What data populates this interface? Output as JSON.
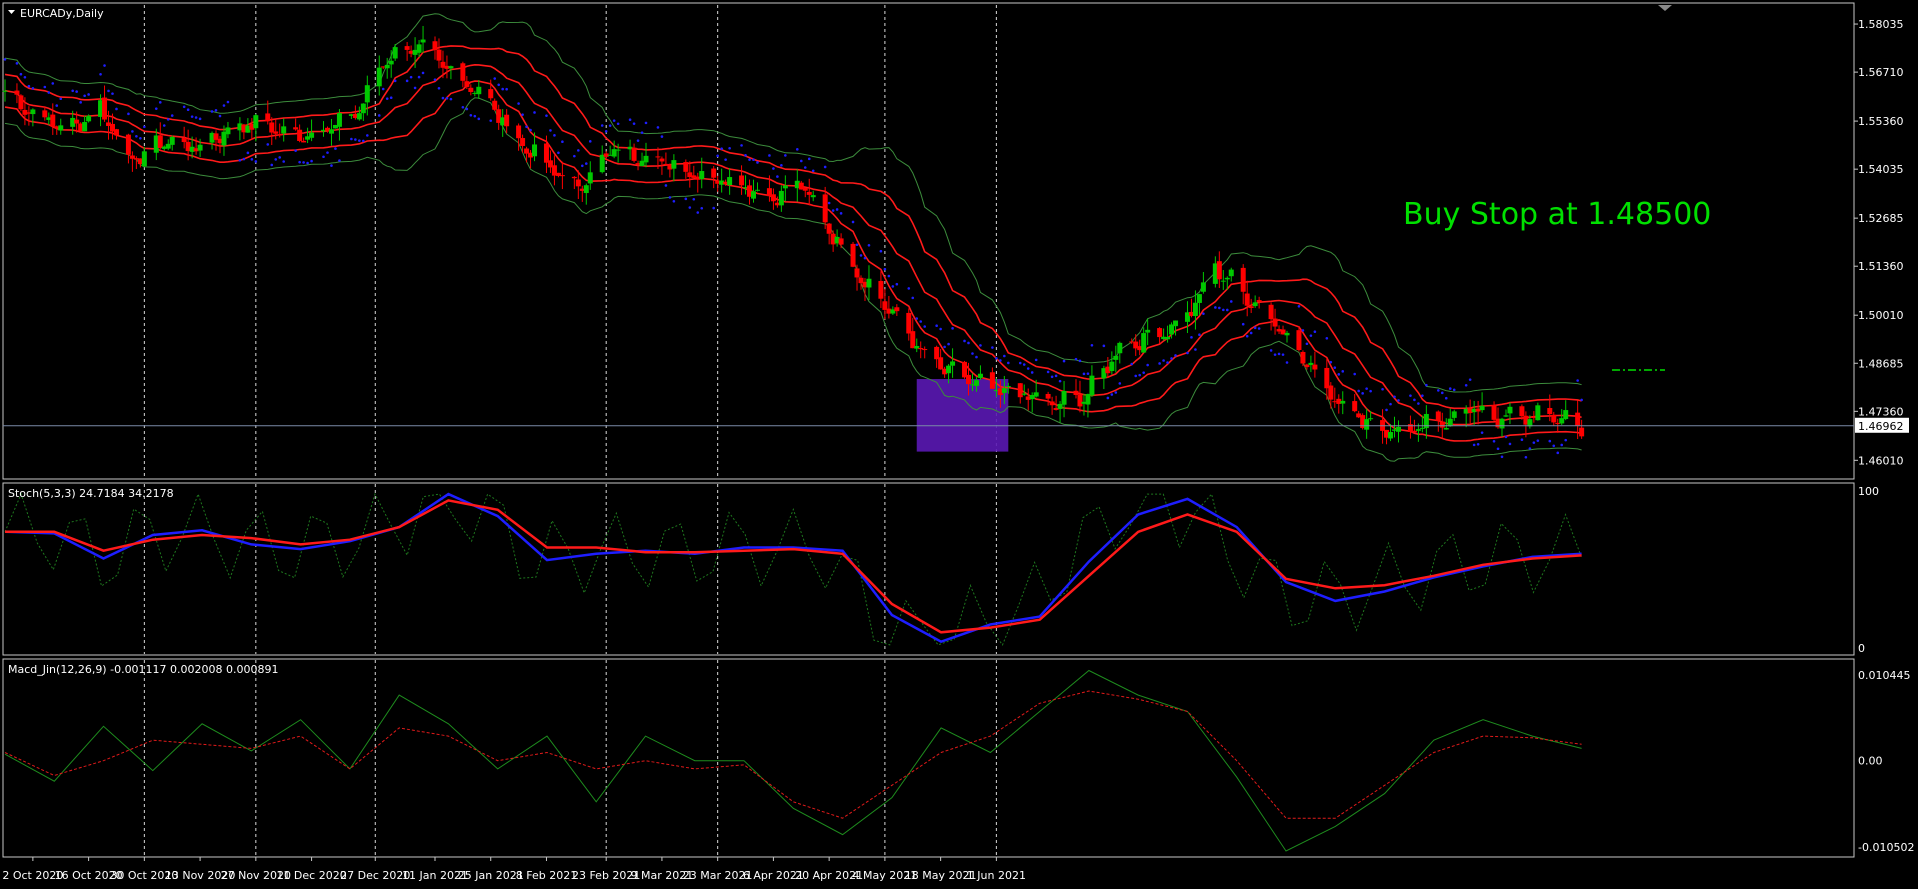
{
  "window": {
    "symbol_label": "EURCADy,Daily",
    "annotation_text": "Buy Stop at 1.48500",
    "current_price_label": "1.46962",
    "panes": {
      "stoch_label": "Stoch(5,3,3) 24.7184 34.2178",
      "macd_label": "Macd_Jin(12,26,9) -0.001117 0.002008 0.000891"
    }
  },
  "colors": {
    "background": "#000000",
    "frame": "#c8c8c8",
    "bull": "#00c800",
    "bear": "#ff0000",
    "ma": "#ff1a1a",
    "bollinger": "#3c8c3c",
    "sar": "#1e1eff",
    "grid": "#ffffff",
    "annotation": "#00e000",
    "box": "#5a18b4",
    "stoch_main": "#1e1eff",
    "stoch_signal": "#ff1a1a",
    "stoch_raw": "#1e781e",
    "macd_line": "#1e8c1e",
    "macd_signal": "#e01a1a",
    "axis_text": "#ffffff"
  },
  "chart_data": [
    {
      "type": "candlestick",
      "pane": "price",
      "ylim": [
        1.4555,
        1.5856
      ],
      "yticks": [
        "1.58035",
        "1.56710",
        "1.55360",
        "1.54035",
        "1.52685",
        "1.51360",
        "1.50010",
        "1.48685",
        "1.47360",
        "1.46010"
      ],
      "xticks": [
        "2 Oct 2020",
        "16 Oct 2020",
        "30 Oct 2020",
        "13 Nov 2020",
        "27 Nov 2020",
        "11 Dec 2020",
        "27 Dec 2020",
        "11 Jan 2021",
        "25 Jan 2021",
        "8 Feb 2021",
        "23 Feb 2021",
        "9 Mar 2021",
        "23 Mar 2021",
        "6 Apr 2021",
        "20 Apr 2021",
        "4 May 2021",
        "18 May 2021",
        "1 Jun 2021"
      ],
      "dashed_verticals": [
        "30 Oct 2020",
        "27 Nov 2020",
        "27 Dec 2020",
        "23 Feb 2021",
        "23 Mar 2021",
        "4 May 2021",
        "1 Jun 2021"
      ],
      "trend_close": [
        [
          0,
          1.562
        ],
        [
          8,
          1.556
        ],
        [
          16,
          1.552
        ],
        [
          24,
          1.558
        ],
        [
          32,
          1.543
        ],
        [
          40,
          1.549
        ],
        [
          48,
          1.547
        ],
        [
          56,
          1.552
        ],
        [
          64,
          1.554
        ],
        [
          72,
          1.55
        ],
        [
          80,
          1.552
        ],
        [
          88,
          1.556
        ],
        [
          96,
          1.572
        ],
        [
          104,
          1.575
        ],
        [
          112,
          1.568
        ],
        [
          120,
          1.562
        ],
        [
          128,
          1.55
        ],
        [
          136,
          1.542
        ],
        [
          144,
          1.536
        ],
        [
          152,
          1.546
        ],
        [
          160,
          1.545
        ],
        [
          168,
          1.542
        ],
        [
          176,
          1.539
        ],
        [
          184,
          1.538
        ],
        [
          192,
          1.533
        ],
        [
          200,
          1.537
        ],
        [
          208,
          1.523
        ],
        [
          216,
          1.51
        ],
        [
          224,
          1.5
        ],
        [
          232,
          1.488
        ],
        [
          240,
          1.484
        ],
        [
          248,
          1.48
        ],
        [
          256,
          1.479
        ],
        [
          264,
          1.476
        ],
        [
          272,
          1.479
        ],
        [
          280,
          1.492
        ],
        [
          288,
          1.495
        ],
        [
          296,
          1.499
        ],
        [
          300,
          1.506
        ],
        [
          304,
          1.514
        ],
        [
          312,
          1.506
        ],
        [
          320,
          1.498
        ],
        [
          328,
          1.486
        ],
        [
          336,
          1.476
        ],
        [
          344,
          1.47
        ],
        [
          352,
          1.468
        ],
        [
          360,
          1.471
        ],
        [
          368,
          1.475
        ],
        [
          376,
          1.472
        ],
        [
          384,
          1.473
        ],
        [
          392,
          1.472
        ],
        [
          396,
          1.47
        ]
      ],
      "buy_stop_level": 1.485,
      "current_price": 1.46962,
      "highlight_box": {
        "from_date": "12 May 2021",
        "to_date": "4 Jun 2021",
        "low": 1.4625,
        "high": 1.4825
      }
    },
    {
      "type": "line",
      "pane": "stochastic",
      "ylim": [
        0,
        100
      ],
      "yticks": [
        "100",
        "0"
      ],
      "series": [
        {
          "values": [
            74,
            73,
            57,
            72,
            75,
            66,
            63,
            68,
            77,
            98,
            84,
            56,
            60,
            62,
            60,
            64,
            64,
            62,
            21,
            4,
            15,
            20,
            55,
            85,
            95,
            77,
            42,
            30,
            36,
            45,
            52,
            58,
            60
          ]
        },
        {
          "values": [
            74,
            74,
            62,
            69,
            72,
            70,
            66,
            69,
            77,
            94,
            88,
            64,
            64,
            61,
            61,
            62,
            63,
            60,
            28,
            10,
            13,
            18,
            46,
            74,
            85,
            74,
            44,
            38,
            40,
            46,
            53,
            57,
            59
          ]
        }
      ]
    },
    {
      "type": "line",
      "pane": "macd",
      "ylim": [
        -0.011,
        0.0113
      ],
      "yticks": [
        "0.010445",
        "0.00",
        "-0.010502"
      ],
      "series": [
        {
          "values": [
            0.0008,
            -0.0025,
            0.0042,
            -0.0012,
            0.0045,
            0.0012,
            0.005,
            -0.001,
            0.008,
            0.0045,
            -0.001,
            0.003,
            -0.005,
            0.003,
            0.0,
            0.0,
            -0.0058,
            -0.009,
            -0.0045,
            0.004,
            0.001,
            0.006,
            0.011,
            0.008,
            0.006,
            -0.002,
            -0.011,
            -0.008,
            -0.004,
            0.0025,
            0.005,
            0.003,
            0.0015
          ]
        },
        {
          "values": [
            0.001,
            -0.0018,
            0.0,
            0.0025,
            0.002,
            0.0015,
            0.003,
            -0.001,
            0.004,
            0.003,
            0.0,
            0.001,
            -0.001,
            0.0,
            -0.001,
            -0.0005,
            -0.005,
            -0.007,
            -0.003,
            0.001,
            0.003,
            0.007,
            0.0085,
            0.0075,
            0.006,
            0.0,
            -0.007,
            -0.007,
            -0.003,
            0.001,
            0.003,
            0.0028,
            0.002
          ]
        }
      ]
    }
  ]
}
